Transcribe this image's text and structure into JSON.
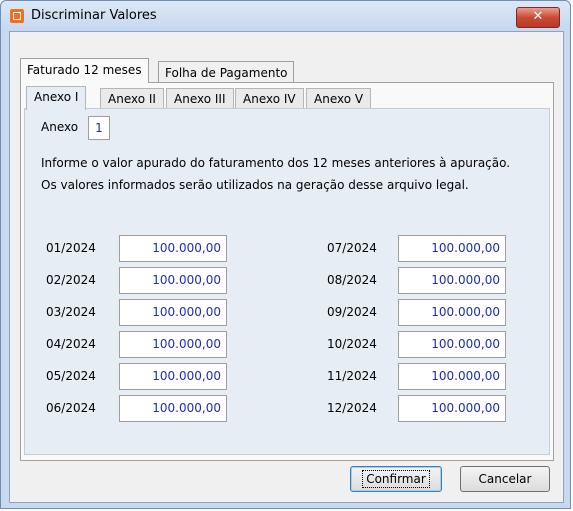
{
  "window": {
    "title": "Discriminar Valores",
    "close_glyph": "✕"
  },
  "tabs": [
    {
      "label": "Faturado 12 meses",
      "active": true
    },
    {
      "label": "Folha de Pagamento",
      "active": false
    }
  ],
  "inner_tabs": [
    {
      "label": "Anexo I",
      "active": true
    },
    {
      "label": "Anexo II",
      "active": false
    },
    {
      "label": "Anexo III",
      "active": false
    },
    {
      "label": "Anexo IV",
      "active": false
    },
    {
      "label": "Anexo V",
      "active": false
    }
  ],
  "anexo": {
    "label": "Anexo",
    "value": "1"
  },
  "info": {
    "line1": "Informe o valor apurado do faturamento dos 12 meses anteriores à apuração.",
    "line2": "Os valores informados serão utilizados na geração desse arquivo legal."
  },
  "months": [
    {
      "label": "01/2024",
      "value": "100.000,00"
    },
    {
      "label": "02/2024",
      "value": "100.000,00"
    },
    {
      "label": "03/2024",
      "value": "100.000,00"
    },
    {
      "label": "04/2024",
      "value": "100.000,00"
    },
    {
      "label": "05/2024",
      "value": "100.000,00"
    },
    {
      "label": "06/2024",
      "value": "100.000,00"
    },
    {
      "label": "07/2024",
      "value": "100.000,00"
    },
    {
      "label": "08/2024",
      "value": "100.000,00"
    },
    {
      "label": "09/2024",
      "value": "100.000,00"
    },
    {
      "label": "10/2024",
      "value": "100.000,00"
    },
    {
      "label": "11/2024",
      "value": "100.000,00"
    },
    {
      "label": "12/2024",
      "value": "100.000,00"
    }
  ],
  "buttons": {
    "confirm": "Confirmar",
    "cancel": "Cancelar"
  },
  "colors": {
    "value_text": "#1a2fa8",
    "close_button": "#c94a35"
  }
}
